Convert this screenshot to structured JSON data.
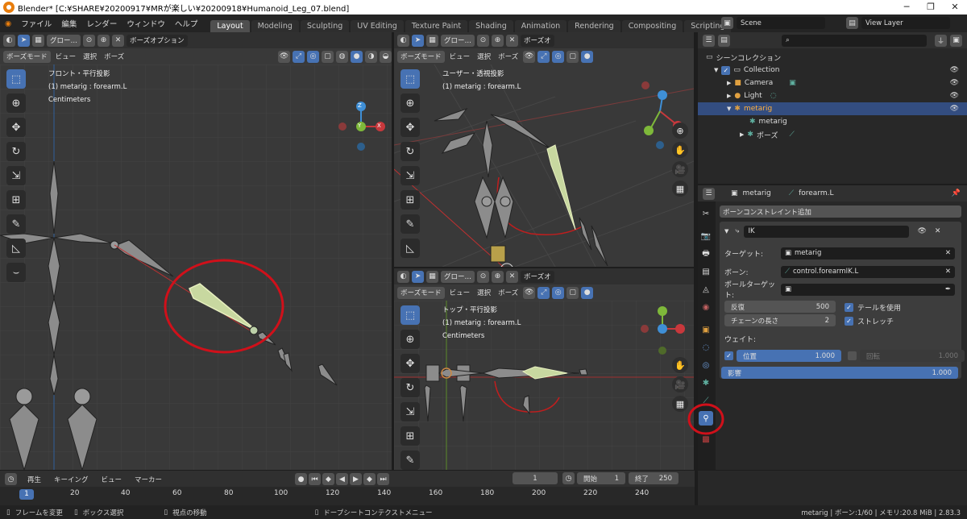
{
  "titlebar": {
    "title": "Blender* [C:¥SHARE¥20200917¥MRが楽しい¥20200918¥Humanoid_Leg_07.blend]"
  },
  "menu": [
    "ファイル",
    "編集",
    "レンダー",
    "ウィンドウ",
    "ヘルプ"
  ],
  "workspaces": [
    "Layout",
    "Modeling",
    "Sculpting",
    "UV Editing",
    "Texture Paint",
    "Shading",
    "Animation",
    "Rendering",
    "Compositing",
    "Scripting",
    "+"
  ],
  "scene": {
    "name": "Scene",
    "view_layer": "View Layer"
  },
  "viewport_header": {
    "transform": "グロー…",
    "pose_options": "ボーズオプション",
    "pose_options_short": "ボーズオ",
    "mode": "ボーズモード",
    "view": "ビュー",
    "select": "選択",
    "pose": "ボーズ"
  },
  "viewports": {
    "front": {
      "line1": "フロント・平行投影",
      "line2": "(1) metarig : forearm.L",
      "line3": "Centimeters"
    },
    "user": {
      "line1": "ユーザー・透視投影",
      "line2": "(1) metarig : forearm.L"
    },
    "top": {
      "line1": "トップ・平行投影",
      "line2": "(1) metarig : forearm.L",
      "line3": "Centimeters"
    }
  },
  "gizmo": {
    "z": "Z",
    "y": "Y",
    "x": "X"
  },
  "outliner": {
    "root": "シーンコレクション",
    "items": [
      {
        "label": "Collection",
        "indent": 1
      },
      {
        "label": "Camera",
        "indent": 2
      },
      {
        "label": "Light",
        "indent": 2
      },
      {
        "label": "metarig",
        "indent": 2,
        "selected": true
      },
      {
        "label": "metarig",
        "indent": 3
      },
      {
        "label": "ポーズ",
        "indent": 3
      }
    ]
  },
  "properties": {
    "breadcrumb_obj": "metarig",
    "breadcrumb_bone": "forearm.L",
    "add_constraint": "ボーンコンストレイント追加",
    "constraint_name": "IK",
    "target_label": "ターゲット:",
    "target_value": "metarig",
    "bone_label": "ボーン:",
    "bone_value": "control.forearmIK.L",
    "pole_label": "ポールターゲット:",
    "iterations_label": "反復",
    "iterations_value": "500",
    "chain_label": "チェーンの長さ",
    "chain_value": "2",
    "use_tail": "テールを使用",
    "stretch": "ストレッチ",
    "weight_label": "ウェイト:",
    "position_label": "位置",
    "position_value": "1.000",
    "rotation_label": "回転",
    "rotation_value": "1.000",
    "influence_label": "影響",
    "influence_value": "1.000"
  },
  "timeline": {
    "playback": "再生",
    "keying": "キーイング",
    "view": "ビュー",
    "marker": "マーカー",
    "current_frame": "1",
    "start_label": "開始",
    "start_value": "1",
    "end_label": "終了",
    "end_value": "250",
    "ticks": [
      "1",
      "20",
      "40",
      "60",
      "80",
      "100",
      "120",
      "140",
      "160",
      "180",
      "200",
      "220",
      "240"
    ]
  },
  "status": {
    "left1": "フレームを変更",
    "left2": "ボックス選択",
    "left3": "視点の移動",
    "center": "ドープシートコンテクストメニュー",
    "right": "metarig | ボーン:1/60 | メモリ:20.8 MiB | 2.83.3"
  },
  "colors": {
    "accent": "#4772b3",
    "highlight_circle": "#d0101a",
    "bone": "#8c8c8c",
    "selected_bone": "#c8d8a0"
  }
}
